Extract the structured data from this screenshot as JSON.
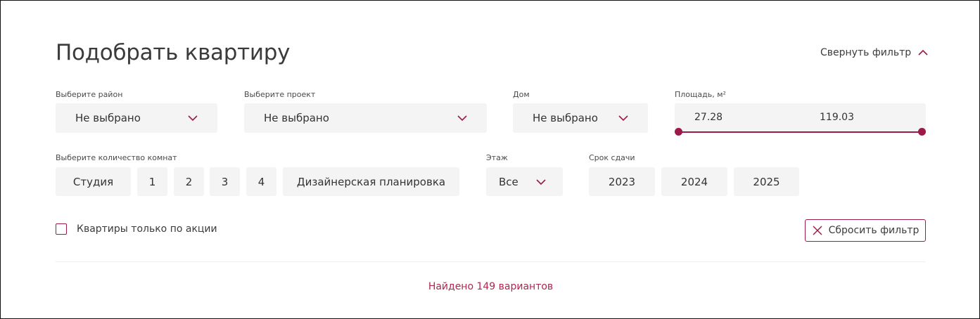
{
  "title": "Подобрать квартиру",
  "collapse_label": "Свернуть фильтр",
  "district": {
    "label": "Выберите район",
    "value": "Не выбрано"
  },
  "project": {
    "label": "Выберите проект",
    "value": "Не выбрано"
  },
  "house": {
    "label": "Дом",
    "value": "Не выбрано"
  },
  "area": {
    "label": "Площадь, м²",
    "min": "27.28",
    "max": "119.03"
  },
  "rooms": {
    "label": "Выберите количество комнат",
    "options": [
      "Студия",
      "1",
      "2",
      "3",
      "4",
      "Дизайнерская планировка"
    ]
  },
  "floor": {
    "label": "Этаж",
    "value": "Все"
  },
  "deadline": {
    "label": "Срок сдачи",
    "options": [
      "2023",
      "2024",
      "2025"
    ]
  },
  "promo_label": "Квартиры только по акции",
  "reset_label": "Сбросить фильтр",
  "found_text": "Найдено 149 вариантов",
  "colors": {
    "accent": "#9b1a4a",
    "found": "#b0264f",
    "field_bg": "#f4f4f4"
  }
}
